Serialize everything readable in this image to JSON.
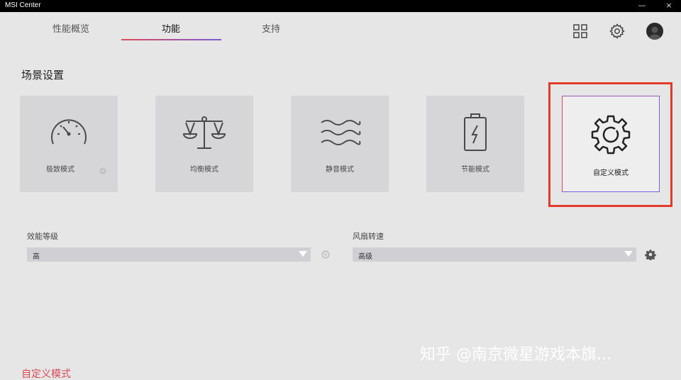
{
  "window": {
    "title": "MSI Center",
    "controls": [
      "—",
      "×"
    ]
  },
  "tabs": [
    {
      "label": "性能概览",
      "active": false
    },
    {
      "label": "功能",
      "active": true
    },
    {
      "label": "支持",
      "active": false
    }
  ],
  "header_icons": [
    "grid-icon",
    "gear-icon",
    "avatar"
  ],
  "section": {
    "title": "场景设置"
  },
  "modes": [
    {
      "label": "极致模式",
      "icon": "speedometer-icon"
    },
    {
      "label": "均衡模式",
      "icon": "balance-scale-icon"
    },
    {
      "label": "静音模式",
      "icon": "waves-icon"
    },
    {
      "label": "节能模式",
      "icon": "battery-charging-icon"
    },
    {
      "label": "自定义模式",
      "icon": "gear-icon",
      "selected": true
    }
  ],
  "performance": {
    "label": "效能等级",
    "value": "高"
  },
  "fan": {
    "label": "风扇转速",
    "value": "高级"
  },
  "watermark": "知乎 @南京微星游戏本旗...",
  "footer": {
    "current_mode": "自定义模式"
  },
  "colors": {
    "accent_red": "#d84a55",
    "accent_purple": "#7a5ad6",
    "highlight": "#e03b2c"
  }
}
